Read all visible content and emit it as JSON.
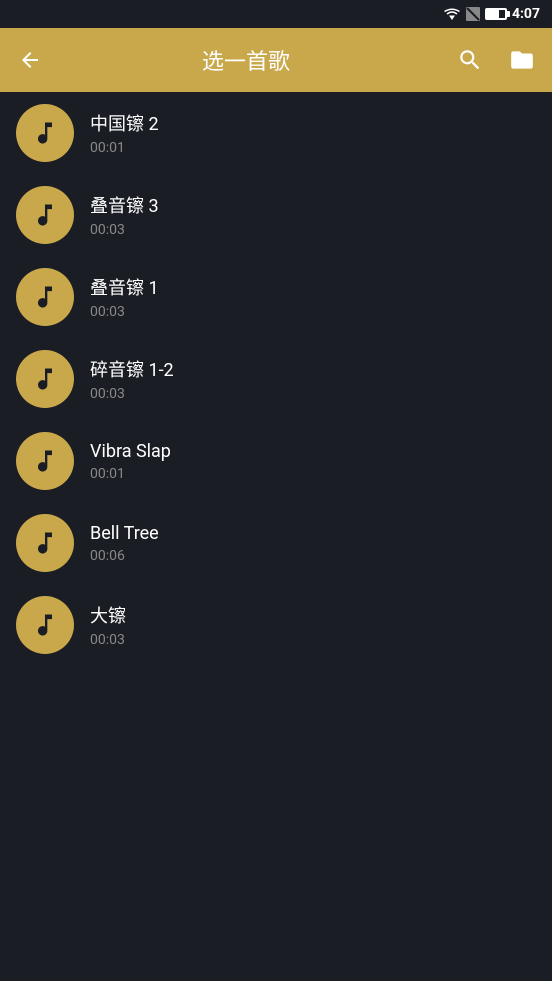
{
  "statusBar": {
    "time": "4:07"
  },
  "appBar": {
    "title": "选一首歌",
    "backLabel": "←",
    "searchLabel": "⌕",
    "folderLabel": "🗁"
  },
  "songs": [
    {
      "id": 1,
      "title": "中国镲 2",
      "duration": "00:01"
    },
    {
      "id": 2,
      "title": "叠音镲 3",
      "duration": "00:03"
    },
    {
      "id": 3,
      "title": "叠音镲 1",
      "duration": "00:03"
    },
    {
      "id": 4,
      "title": "碎音镲 1-2",
      "duration": "00:03"
    },
    {
      "id": 5,
      "title": "Vibra Slap",
      "duration": "00:01"
    },
    {
      "id": 6,
      "title": "Bell Tree",
      "duration": "00:06"
    },
    {
      "id": 7,
      "title": "大镲",
      "duration": "00:03"
    }
  ],
  "icons": {
    "music_note": "♪"
  }
}
